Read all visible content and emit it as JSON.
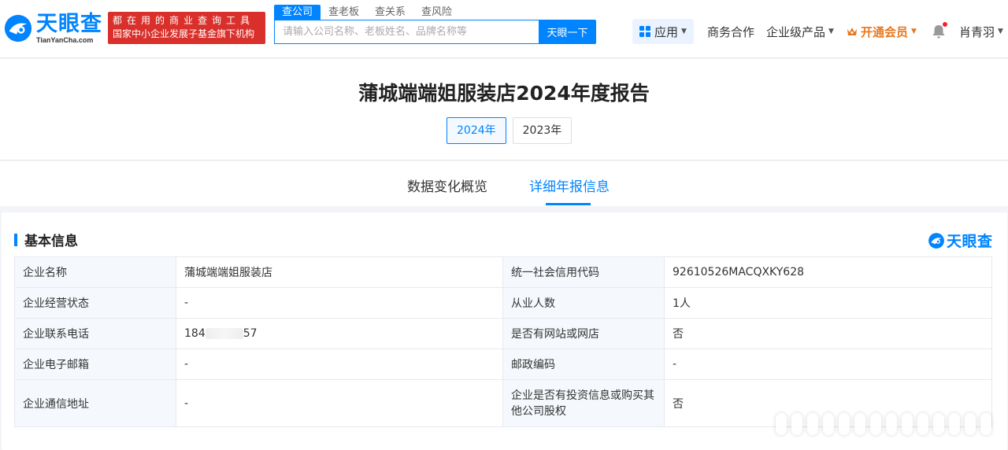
{
  "header": {
    "logo_cn": "天眼查",
    "logo_en": "TianYanCha.com",
    "slogan_line1": "都在用的商业查询工具",
    "slogan_line2": "国家中小企业发展子基金旗下机构",
    "search_tabs": [
      "查公司",
      "查老板",
      "查关系",
      "查风险"
    ],
    "search_placeholder": "请输入公司名称、老板姓名、品牌名称等",
    "search_button": "天眼一下",
    "nav_apps": "应用",
    "nav_biz": "商务合作",
    "nav_enterprise": "企业级产品",
    "nav_vip": "开通会员",
    "user_name": "肖青羽",
    "accent_color": "#0084ff",
    "vip_color": "#e6771f",
    "slogan_bg": "#d9302b"
  },
  "report": {
    "title": "蒲城端端姐服装店2024年度报告",
    "years": [
      "2024年",
      "2023年"
    ],
    "active_year": "2024年"
  },
  "section_tabs": [
    "数据变化概览",
    "详细年报信息"
  ],
  "basic": {
    "title": "基本信息",
    "watermark": "天眼查",
    "rows": [
      {
        "k1": "企业名称",
        "v1": "蒲城端端姐服装店",
        "k2": "统一社会信用代码",
        "v2": "92610526MACQXKY628"
      },
      {
        "k1": "企业经营状态",
        "v1": "-",
        "k2": "从业人数",
        "v2": "1人"
      },
      {
        "k1": "企业联系电话",
        "v1_prefix": "184",
        "v1_suffix": "57",
        "k2": "是否有网站或网店",
        "v2": "否"
      },
      {
        "k1": "企业电子邮箱",
        "v1": "-",
        "k2": "邮政编码",
        "v2": "-"
      },
      {
        "k1": "企业通信地址",
        "v1": "-",
        "k2_line1": "企业是否有投资信息或购买其",
        "k2_line2": "他公司股权",
        "v2": "否"
      }
    ]
  }
}
